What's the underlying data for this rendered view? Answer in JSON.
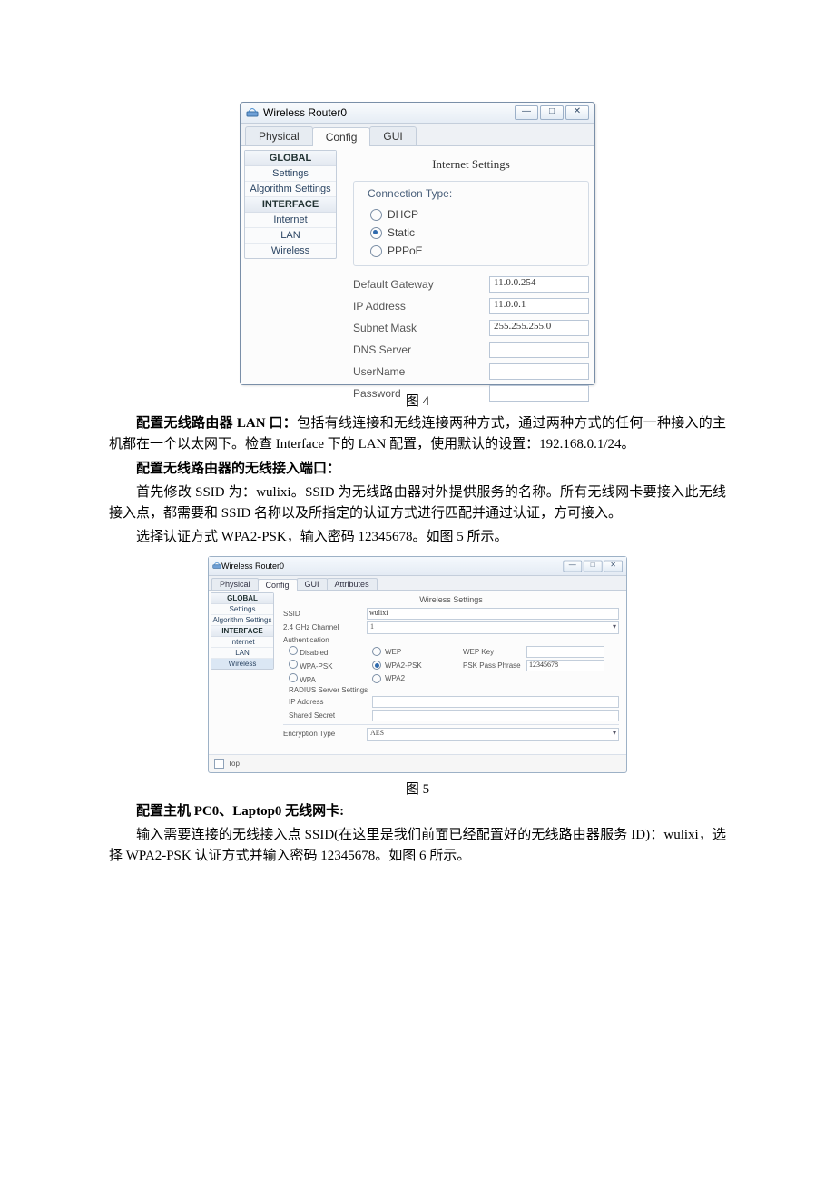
{
  "fig4": {
    "window_title": "Wireless Router0",
    "tabs": [
      "Physical",
      "Config",
      "GUI"
    ],
    "active_tab": "Config",
    "sidebar": {
      "global_header": "GLOBAL",
      "settings": "Settings",
      "algo": "Algorithm Settings",
      "interface_header": "INTERFACE",
      "internet": "Internet",
      "lan": "LAN",
      "wireless": "Wireless"
    },
    "panel_title": "Internet Settings",
    "conn_legend": "Connection Type:",
    "radios": {
      "dhcp": "DHCP",
      "static": "Static",
      "pppoe": "PPPoE"
    },
    "fields": {
      "gw_label": "Default Gateway",
      "gw": "11.0.0.254",
      "ip_label": "IP Address",
      "ip": "11.0.0.1",
      "mask_label": "Subnet Mask",
      "mask": "255.255.255.0",
      "dns_label": "DNS Server",
      "dns": "",
      "user_label": "UserName",
      "user": "",
      "pass_label": "Password",
      "pass": ""
    }
  },
  "text": {
    "cap4": "图 4",
    "p1a": "配置无线路由器 LAN 口：",
    "p1b": "包括有线连接和无线连接两种方式，通过两种方式的任何一种接入的主机都在一个以太网下。检查 Interface 下的 LAN 配置，使用默认的设置：192.168.0.1/24。",
    "p2": "配置无线路由器的无线接入端口：",
    "p3": "首先修改 SSID 为：wulixi。SSID 为无线路由器对外提供服务的名称。所有无线网卡要接入此无线接入点，都需要和 SSID 名称以及所指定的认证方式进行匹配并通过认证，方可接入。",
    "p4": "选择认证方式 WPA2-PSK，输入密码 12345678。如图 5 所示。",
    "cap5": "图 5",
    "p5": "配置主机 PC0、Laptop0 无线网卡:",
    "p6": "输入需要连接的无线接入点 SSID(在这里是我们前面已经配置好的无线路由器服务 ID)：wulixi，选择 WPA2-PSK 认证方式并输入密码 12345678。如图 6 所示。"
  },
  "fig5": {
    "window_title": "Wireless Router0",
    "tabs": [
      "Physical",
      "Config",
      "GUI",
      "Attributes"
    ],
    "active_tab": "Config",
    "sidebar": {
      "global_header": "GLOBAL",
      "settings": "Settings",
      "algo": "Algorithm Settings",
      "interface_header": "INTERFACE",
      "internet": "Internet",
      "lan": "LAN",
      "wireless": "Wireless"
    },
    "panel_title": "Wireless Settings",
    "ssid_label": "SSID",
    "ssid": "wulixi",
    "channel_label": "2.4 GHz Channel",
    "channel": "1",
    "auth_label": "Authentication",
    "auth": {
      "disabled": "Disabled",
      "wep": "WEP",
      "wep_key_label": "WEP Key",
      "wpa_psk": "WPA-PSK",
      "wpa2_psk": "WPA2-PSK",
      "psk_label": "PSK Pass Phrase",
      "psk_value": "12345678",
      "wpa": "WPA",
      "wpa2": "WPA2"
    },
    "radius_label": "RADIUS Server Settings",
    "radius_ip_label": "IP Address",
    "radius_secret_label": "Shared Secret",
    "enc_label": "Encryption Type",
    "enc_value": "AES",
    "top_label": "Top"
  }
}
